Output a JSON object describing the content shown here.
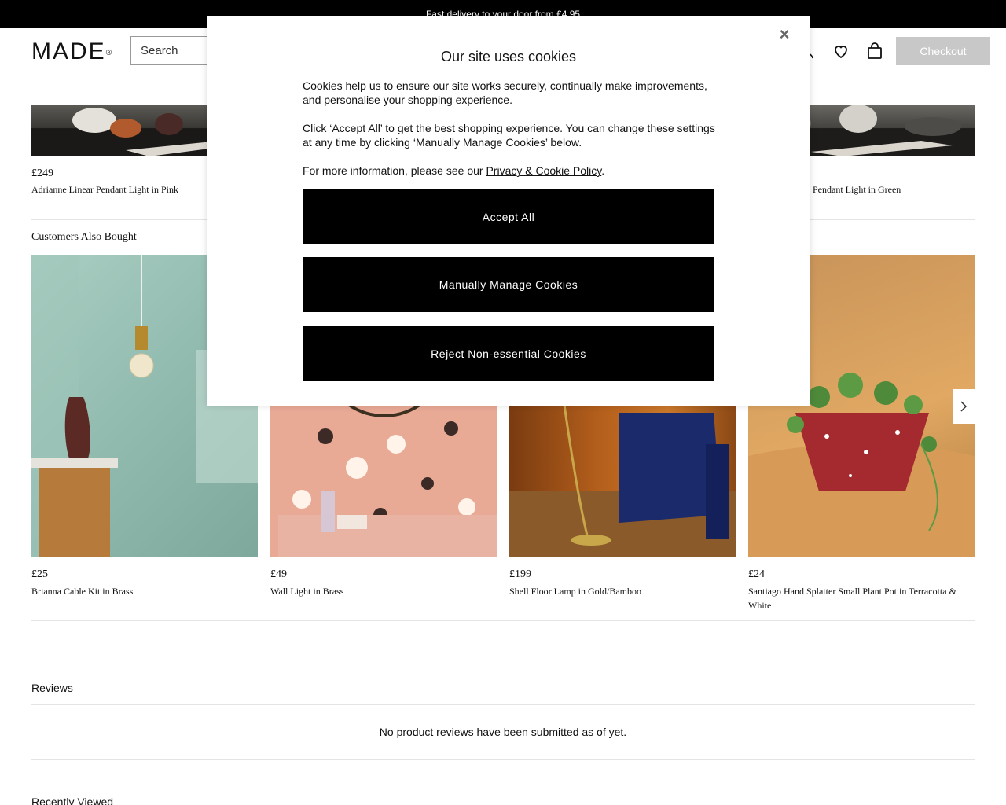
{
  "promo": {
    "text": "Fast delivery to your door from £4.95"
  },
  "header": {
    "logo": "MADE",
    "logo_mark": "®",
    "search_placeholder": "Search",
    "checkout_label": "Checkout"
  },
  "top_products": [
    {
      "price": "£249",
      "name": "Adrianne Linear Pendant Light in Pink"
    },
    {
      "price": "",
      "name": "Pendant Light in Green"
    }
  ],
  "also_bought": {
    "title": "Customers Also Bought",
    "items": [
      {
        "price": "£25",
        "name": "Brianna Cable Kit in Brass"
      },
      {
        "price": "£49",
        "name": "Wall Light in Brass"
      },
      {
        "price": "£199",
        "name": "Shell Floor Lamp in Gold/Bamboo"
      },
      {
        "price": "£24",
        "name": "Santiago Hand Splatter Small Plant Pot in Terracotta & White"
      }
    ]
  },
  "reviews": {
    "title": "Reviews",
    "empty": "No product reviews have been submitted as of yet."
  },
  "recently_viewed": {
    "title": "Recently Viewed"
  },
  "cookie_modal": {
    "close_icon": "×",
    "title": "Our site uses cookies",
    "para1": "Cookies help us to ensure our site works securely, continually make improvements, and personalise your shopping experience.",
    "para2": "Click ‘Accept All’ to get the best shopping experience. You can change these settings at any time by clicking ‘Manually Manage Cookies’ below.",
    "para3_prefix": "For more information, please see our ",
    "policy_link": "Privacy & Cookie Policy",
    "para3_suffix": ".",
    "accept_all": "Accept All",
    "manage": "Manually Manage Cookies",
    "reject": "Reject Non-essential Cookies"
  }
}
